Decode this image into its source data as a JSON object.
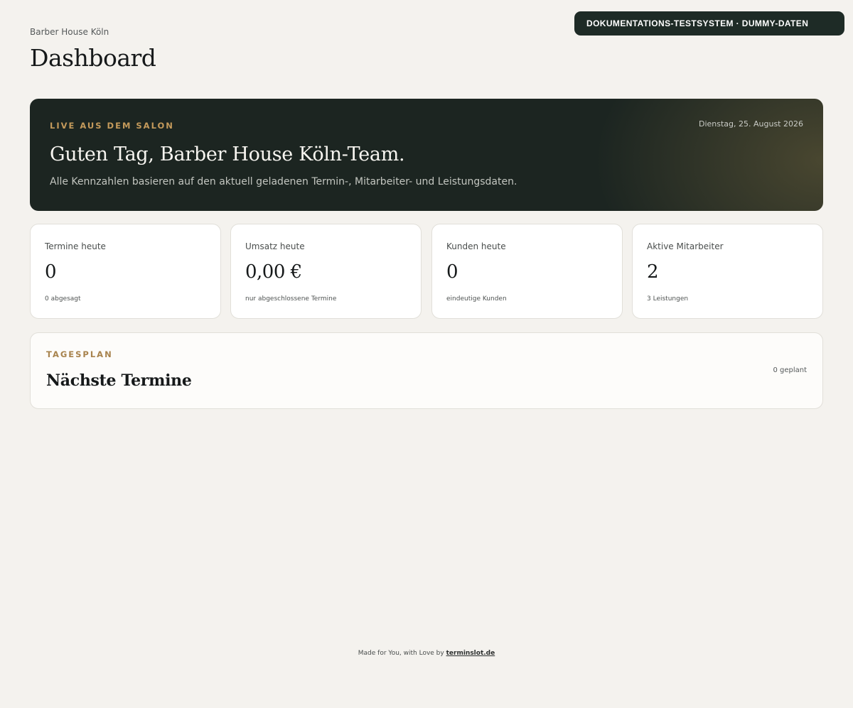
{
  "badge": {
    "text": "DOKUMENTATIONS-TESTSYSTEM · DUMMY-DATEN"
  },
  "header": {
    "salon_name": "Barber House Köln",
    "title": "Dashboard"
  },
  "hero": {
    "eyebrow": "LIVE AUS DEM SALON",
    "date": "Dienstag, 25. August 2026",
    "greeting": "Guten Tag, Barber House Köln-Team.",
    "subtitle": "Alle Kennzahlen basieren auf den aktuell geladenen Termin-, Mitarbeiter- und Leistungsdaten."
  },
  "stats": [
    {
      "label": "Termine heute",
      "value": "0",
      "note": "0 abgesagt"
    },
    {
      "label": "Umsatz heute",
      "value": "0,00 €",
      "note": "nur abgeschlossene Termine"
    },
    {
      "label": "Kunden heute",
      "value": "0",
      "note": "eindeutige Kunden"
    },
    {
      "label": "Aktive Mitarbeiter",
      "value": "2",
      "note": "3 Leistungen"
    }
  ],
  "schedule": {
    "eyebrow": "TAGESPLAN",
    "title": "Nächste Termine",
    "count": "0 geplant"
  },
  "footer": {
    "text": "Made for You, with Love by",
    "link": "terminslot.de"
  },
  "colors": {
    "accent": "#c49a5b",
    "hero_bg": "#1c2521",
    "badge_bg": "#1e2b26",
    "page_bg": "#f4f2ee"
  }
}
